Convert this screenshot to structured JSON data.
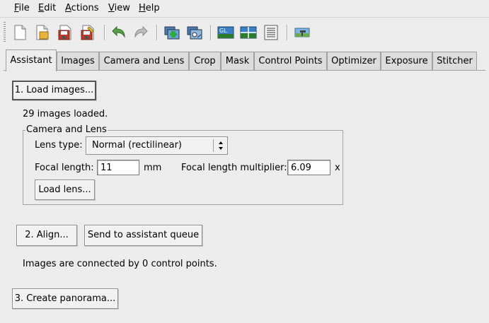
{
  "menu": {
    "file": {
      "mnemonic": "F",
      "rest": "ile"
    },
    "edit": {
      "mnemonic": "E",
      "rest": "dit"
    },
    "actions": {
      "mnemonic": "A",
      "rest": "ctions"
    },
    "view": {
      "mnemonic": "V",
      "rest": "iew"
    },
    "help": {
      "mnemonic": "H",
      "rest": "elp"
    }
  },
  "toolbar": {
    "icons": [
      "new-project-icon",
      "open-project-icon",
      "save-project-icon",
      "save-as-icon",
      "undo-icon",
      "redo-icon",
      "add-images-icon",
      "add-time-series-icon",
      "opengl-preview-icon",
      "fast-preview-icon",
      "batch-list-icon",
      "stitch-icon"
    ]
  },
  "tabs": [
    "Assistant",
    "Images",
    "Camera and Lens",
    "Crop",
    "Mask",
    "Control Points",
    "Optimizer",
    "Exposure",
    "Stitcher"
  ],
  "active_tab": "Assistant",
  "assistant": {
    "load_images_label": "1. Load images...",
    "images_loaded_text": "29 images loaded.",
    "camera_group_title": "Camera and Lens",
    "lens_type_label": "Lens type:",
    "lens_type_value": "Normal (rectilinear)",
    "focal_length_label": "Focal length:",
    "focal_length_value": "11",
    "focal_length_unit": "mm",
    "multiplier_label": "Focal length multiplier:",
    "multiplier_value": "6.09",
    "multiplier_unit": "x",
    "load_lens_label": "Load lens...",
    "align_label": "2. Align...",
    "send_queue_label": "Send to assistant queue",
    "control_points_text": "Images are connected by 0 control points.",
    "create_panorama_label": "3. Create panorama..."
  }
}
